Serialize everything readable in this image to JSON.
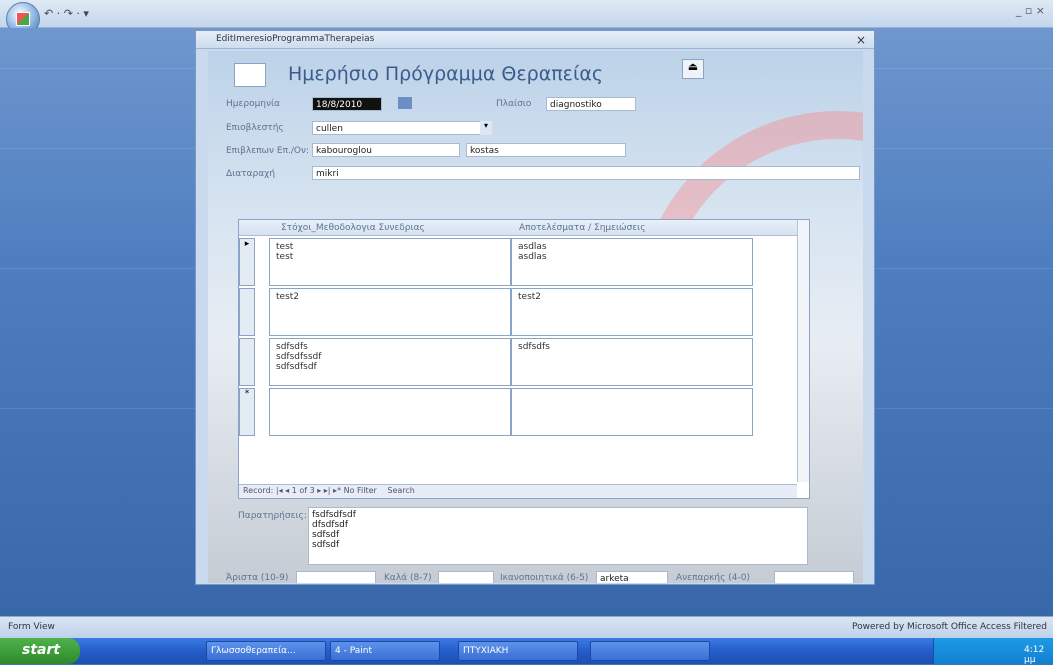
{
  "app": {
    "qat_icons": "↶ · ↷ · ▾",
    "window_controls": "_ ▫ ×"
  },
  "form": {
    "window_title": "EditImeresioProgrammaTherapeias",
    "heading": "Ημερήσιο Πρόγραμμα Θεραπείας",
    "date_label": "Ημερομηνία",
    "date_value": "18/8/2010",
    "context_label": "Πλαίσιο",
    "context_value": "diagnostiko",
    "supervisor_label": "Επιοβλεστής",
    "supervisor_value": "cullen",
    "responsible_label": "Επιβλεπων Επ./Ον:",
    "responsible_last": "kabouroglou",
    "responsible_first": "kostas",
    "disorder_label": "Διαταραχή",
    "disorder_value": "mikri",
    "sub_col1": "Στόχοι_Μεθοδολογια Συνεδριας",
    "sub_col2": "Αποτελέσματα / Σημειώσεις",
    "rows": [
      {
        "goal": "test\ntest",
        "result": "asdlas\nasdlas"
      },
      {
        "goal": "test2",
        "result": "test2"
      },
      {
        "goal": "sdfsdfs\nsdfsdfssdf\nsdfsdfsdf",
        "result": "sdfsdfs"
      },
      {
        "goal": "",
        "result": ""
      }
    ],
    "nav": {
      "record_label": "Record:",
      "position": "1 of 3",
      "filter": "No Filter",
      "search": "Search"
    },
    "remarks_label": "Παρατηρήσεις:",
    "remarks_value": "fsdfsdfsdf\ndfsdfsdf\nsdfsdf\nsdfsdf",
    "grade1_label": "Άριστα (10-9)",
    "grade1_value": "",
    "grade2_label": "Καλά (8-7)",
    "grade2_value": "",
    "grade3_label": "Ικανοποιητικά (6-5)",
    "grade3_value": "arketa",
    "grade4_label": "Ανεπαρκής (4-0)",
    "grade4_value": ""
  },
  "status": {
    "left": "Form View",
    "right": "Powered by Microsoft Office Access   Filtered"
  },
  "taskbar": {
    "start": "start",
    "items": [
      "Γλωσσοθεραπεία...",
      "4 - Paint",
      "ΠΤΥΧΙΑΚΗ",
      ""
    ],
    "clock": "4:12 μμ"
  },
  "colors": {
    "accent": "#3c74b8",
    "label": "#5f7391"
  }
}
